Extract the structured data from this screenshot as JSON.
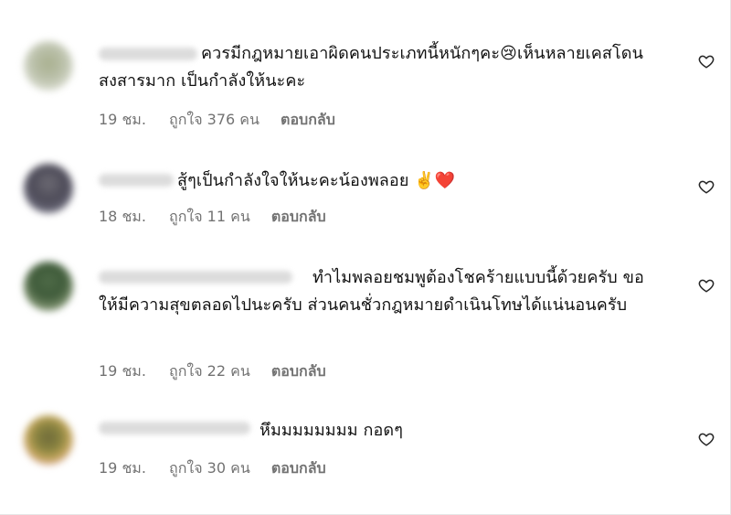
{
  "colors": {
    "meta_text": "#737373",
    "body_text": "#111111",
    "heart_stroke": "#262626"
  },
  "comments": [
    {
      "text": "ควรมีกฎหมายเอาผิดคนประเภทนี้หนักๆคะ😢เห็นหลายเคสโดนสงสารมาก เป็นกำลังให้นะคะ",
      "time": "19 ชม.",
      "likes": "ถูกใจ 376 คน",
      "reply": "ตอบกลับ"
    },
    {
      "text": "สู้ๆเป็นกำลังใจให้นะคะน้องพลอย ✌️❤️",
      "time": "18 ชม.",
      "likes": "ถูกใจ 11 คน",
      "reply": "ตอบกลับ"
    },
    {
      "text": "ทำไมพลอยชมพูต้องโชคร้ายแบบนี้ด้วยครับ ขอให้มีความสุขตลอดไปนะครับ ส่วนคนชั่วกฎหมายดำเนินโทษได้แน่นอนครับ",
      "time": "19 ชม.",
      "likes": "ถูกใจ 22 คน",
      "reply": "ตอบกลับ"
    },
    {
      "text": "หึมมมมมมมม กอดๆ",
      "time": "19 ชม.",
      "likes": "ถูกใจ 30 คน",
      "reply": "ตอบกลับ"
    }
  ],
  "icons": {
    "like": "heart-outline-icon"
  }
}
